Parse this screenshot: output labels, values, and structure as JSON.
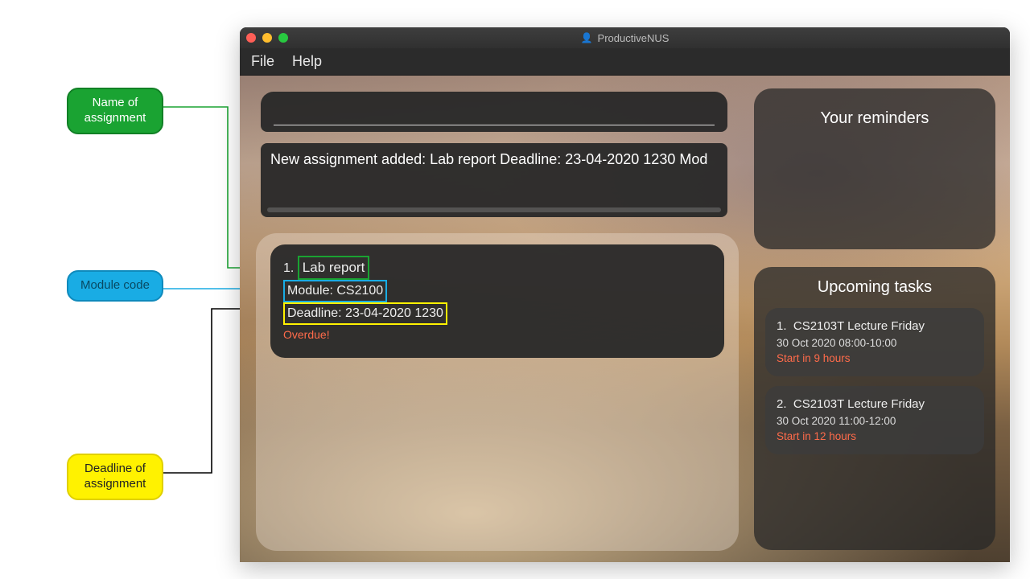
{
  "titlebar": {
    "title": "ProductiveNUS"
  },
  "menu": {
    "file": "File",
    "help": "Help"
  },
  "message": "New assignment added: Lab report Deadline: 23-04-2020 1230 Mod",
  "assignment": {
    "index": "1.",
    "name": "Lab report",
    "module": "Module: CS2100",
    "deadline": "Deadline: 23-04-2020 1230",
    "overdue": "Overdue!"
  },
  "reminders": {
    "heading": "Your reminders"
  },
  "upcoming": {
    "heading": "Upcoming tasks",
    "tasks": [
      {
        "index": "1.",
        "title": "CS2103T Lecture Friday",
        "sub": "30 Oct 2020 08:00-10:00",
        "start": "Start in 9 hours"
      },
      {
        "index": "2.",
        "title": "CS2103T Lecture Friday",
        "sub": "30 Oct 2020 11:00-12:00",
        "start": "Start in 12 hours"
      }
    ]
  },
  "callouts": {
    "name": "Name of assignment",
    "module": "Module code",
    "deadline": "Deadline of assignment"
  },
  "colors": {
    "green": "#1aa332",
    "blue": "#19ace4",
    "yellow": "#fff200",
    "overdue": "#ff6b4a"
  }
}
